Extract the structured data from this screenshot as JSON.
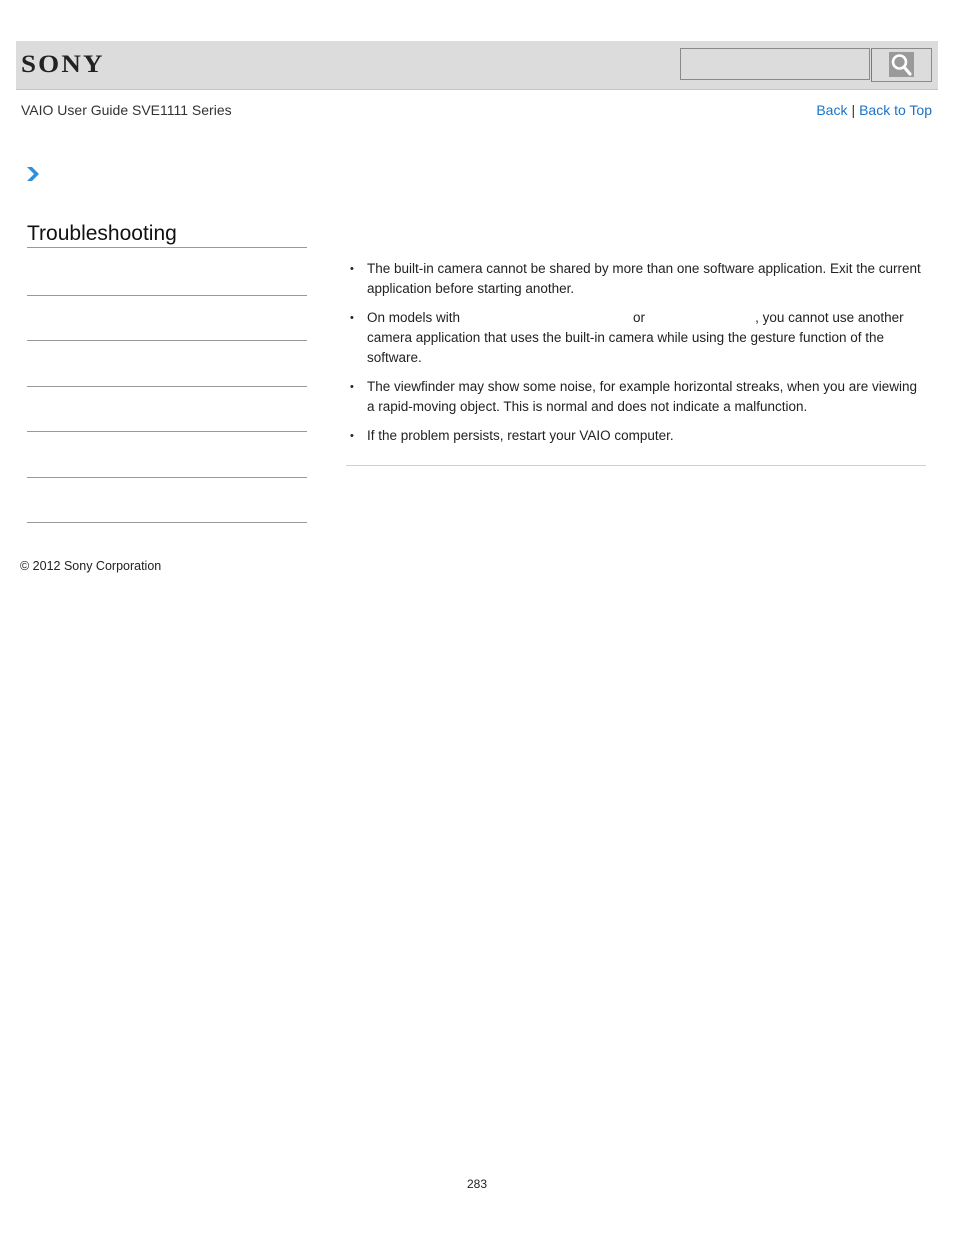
{
  "header": {
    "brand": "SONY",
    "search": {
      "value": "",
      "placeholder": ""
    },
    "search_button_icon": "search-icon"
  },
  "guide": {
    "title": "VAIO User Guide SVE1111 Series"
  },
  "top_nav": {
    "back": "Back",
    "separator": "|",
    "back_to_top": "Back to Top"
  },
  "breadcrumb": {
    "icon": "chevron-right-icon",
    "accent_color": "#2f8fd8"
  },
  "sidebar": {
    "title": "Troubleshooting",
    "items": [
      "",
      "",
      "",
      "",
      "",
      ""
    ]
  },
  "content": {
    "bullets": [
      {
        "text": "The built-in camera cannot be shared by more than one software application. Exit the current application before starting another."
      },
      {
        "prefix": "On models with",
        "middle": "or",
        "suffix": ", you cannot use another camera application that uses the built-in camera while using the gesture function of the software."
      },
      {
        "text": "The viewfinder may show some noise, for example horizontal streaks, when you are viewing a rapid-moving object. This is normal and does not indicate a malfunction."
      },
      {
        "text": "If the problem persists, restart your VAIO computer."
      }
    ],
    "bullet_glyph": "•"
  },
  "footer": {
    "copyright": "© 2012 Sony Corporation",
    "page_number": "283"
  }
}
